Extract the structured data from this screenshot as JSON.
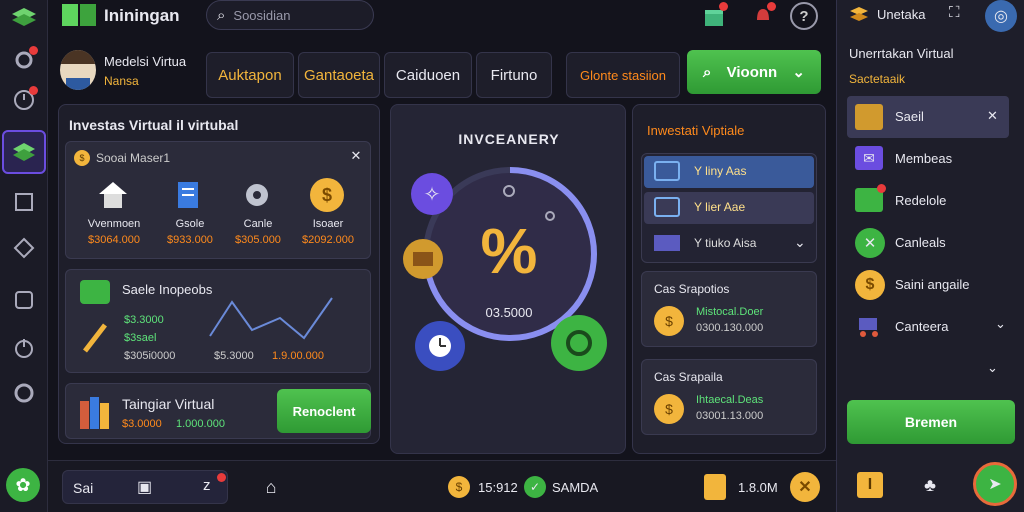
{
  "app": {
    "title": "Ininingan",
    "search_placeholder": "Soosidian"
  },
  "profile": {
    "name": "Medelsi Virtua",
    "subtitle": "Nansa"
  },
  "tabs": [
    "Auktapon",
    "Gantaoeta",
    "Caiduoen",
    "Firtuno",
    "Glonte stasiion"
  ],
  "search_button": "Vioonn",
  "left_panel": {
    "title": "Investas Virtual il virtubal",
    "sub_title": "Sooai Maser1",
    "items": [
      {
        "label": "Vvenmoen",
        "value": "$3064.000",
        "icon": "house-icon"
      },
      {
        "label": "Gsole",
        "value": "$933.000",
        "icon": "document-icon"
      },
      {
        "label": "Canle",
        "value": "$305.000",
        "icon": "gear-icon"
      },
      {
        "label": "Isoaer",
        "value": "$2092.000",
        "icon": "coin-icon"
      }
    ],
    "chart_card": {
      "title": "Saele Inopeobs",
      "v1": "$3.3000",
      "v2": "$3sael",
      "v3": "$305i0000",
      "v4": "$5.3000",
      "v5": "1.9.00.000"
    },
    "bottom": {
      "title": "Taingiar Virtual",
      "v1": "$3.0000",
      "v2": "1.000.000",
      "button": "Renoclent"
    }
  },
  "center": {
    "title": "INVCEANERY",
    "value": "03.5000"
  },
  "right_panel": {
    "title": "Inwestati Viptiale",
    "rows": [
      {
        "label": "Y liny Aas"
      },
      {
        "label": "Y lier Aae"
      },
      {
        "label": "Y tiuko Aisa"
      }
    ],
    "card1": {
      "title": "Cas Srapotios",
      "line1": "Mistocal.Doer",
      "line2": "0300.130.000"
    },
    "card2": {
      "title": "Cas Srapaila",
      "line1": "Ihtaecal.Deas",
      "line2": "03001.13.000"
    }
  },
  "sidebar": {
    "title": "Unetaka",
    "heading": "Unerrtakan Virtual",
    "subheading": "Sactetaaik",
    "items": [
      {
        "label": "Saeil",
        "icon": "chest-icon"
      },
      {
        "label": "Membeas",
        "icon": "envelope-icon"
      },
      {
        "label": "Redelole",
        "icon": "ledger-icon"
      },
      {
        "label": "Canleals",
        "icon": "clover-icon"
      },
      {
        "label": "Saini angaile",
        "icon": "coin-icon"
      },
      {
        "label": "Canteera",
        "icon": "cart-icon"
      }
    ],
    "button": "Bremen"
  },
  "bottom_bar": {
    "label": "Sai",
    "coins": "15:912",
    "status": "SAMDA",
    "amount": "1.8.0M"
  },
  "colors": {
    "accent_green": "#3db443",
    "gold": "#f2b53c",
    "orange": "#ff8a1c",
    "purple": "#6b4de0"
  }
}
